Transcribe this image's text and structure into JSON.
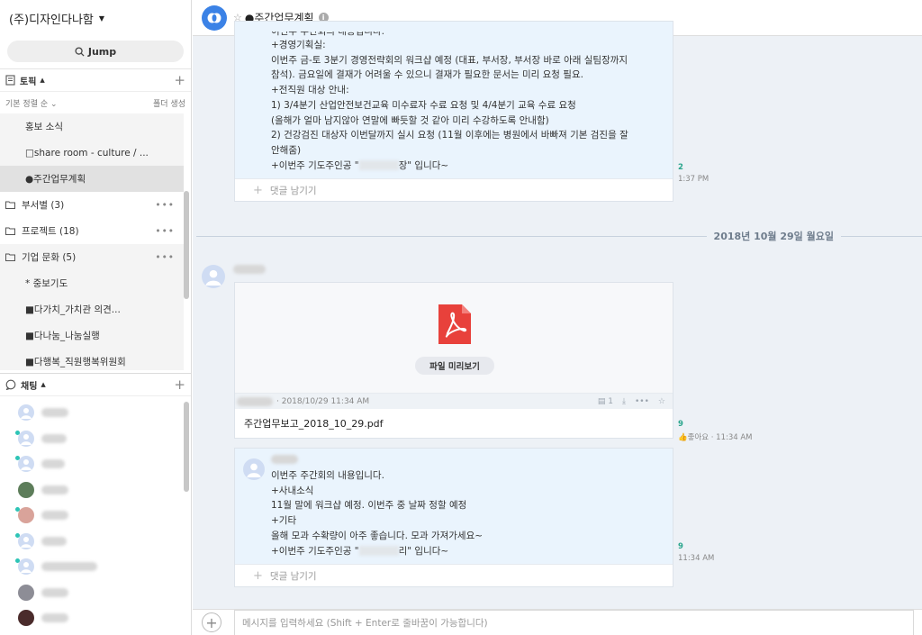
{
  "sidebar": {
    "team_name": "(주)디자인다나함",
    "jump_label": "Jump",
    "topics_label": "토픽",
    "sort_label": "기본 정렬 순 ⌄",
    "folder_create": "폴더 생성",
    "topics": [
      "홍보 소식",
      "□share room - culture / ...",
      "●주간업무계획"
    ],
    "folders": [
      {
        "name": "부서별",
        "count": "(3)"
      },
      {
        "name": "프로젝트",
        "count": "(18)"
      },
      {
        "name": "기업 문화",
        "count": "(5)"
      }
    ],
    "culture_items": [
      "* 중보기도",
      "■다가치_가치관 의견...",
      "■다나눔_나눔실행",
      "■다행복_직원행복위원회"
    ],
    "chat_label": "채팅"
  },
  "header": {
    "room_title": "●주간업무계획"
  },
  "messages": {
    "first": {
      "lines": [
        "이번주 주간회의 내용입니다.",
        "+경영기획실:",
        "이번주 금-토 3분기 경영전략회의 워크샵 예정 (대표, 부서장, 부서장 바로 아래 실팀장까지",
        "참석). 금요일에 결재가 어려울 수 있으니 결재가 필요한 문서는 미리 요청 필요.",
        "+전직원 대상 안내:",
        "1) 3/4분기 산업안전보건교육 미수료자 수료 요청 및 4/4분기 교육 수료 요청",
        "(올해가 얼마 남지않아 연말에 빠듯할 것 같아 미리 수강하도록 안내함)",
        "2) 건강검진 대상자 이번달까지 실시 요청 (11월 이후에는 병원에서 바빠져 기본 검진을 잘",
        "안해줌)"
      ],
      "last_prefix": "+이번주 기도주인공 \"",
      "last_suffix": "장\" 입니다~",
      "count": "2",
      "time": "1:37 PM"
    },
    "comment_label": "댓글 남기기",
    "date_divider": "2018년 10월 29일 월요일",
    "file": {
      "preview_label": "파일 미리보기",
      "meta": "· 2018/10/29 11:34 AM",
      "comment_count": "1",
      "name": "주간업무보고_2018_10_29.pdf",
      "count": "9",
      "like": "좋아요",
      "time": "· 11:34 AM"
    },
    "second": {
      "lines": [
        "이번주 주간회의 내용입니다.",
        "+사내소식",
        "11월 말에 워크샵 예정. 이번주 중 날짜 정할 예정",
        "+기타",
        "올해 모과 수확량이 아주 좋습니다. 모과 가져가세요~"
      ],
      "last_prefix": "+이번주 기도주인공 \"",
      "last_suffix": "리\" 입니다~",
      "count": "9",
      "time": "11:34 AM"
    }
  },
  "composer": {
    "placeholder": "메시지를 입력하세요 (Shift + Enter로 줄바꿈이 가능합니다)"
  },
  "colors": {
    "accent": "#3b82e6",
    "message_bg": "#eaf4fd",
    "main_bg": "#edf1f6",
    "pdf_red": "#e8413b"
  }
}
